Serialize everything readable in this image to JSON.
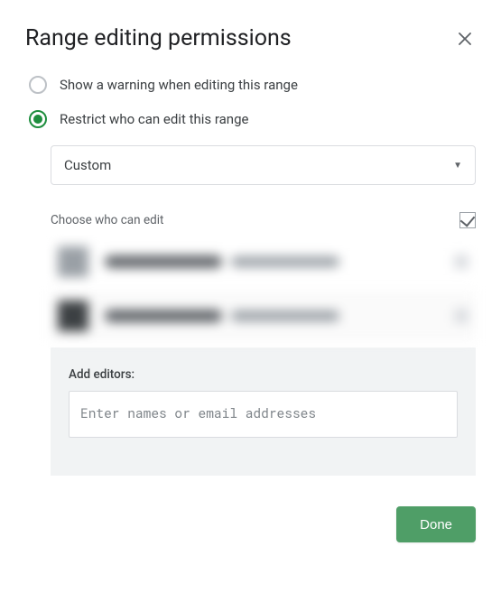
{
  "dialog": {
    "title": "Range editing permissions"
  },
  "radios": {
    "warning_label": "Show a warning when editing this range",
    "restrict_label": "Restrict who can edit this range",
    "selected": "restrict"
  },
  "permission_select": {
    "value": "Custom"
  },
  "choose_label": "Choose who can edit",
  "master_checkbox_checked": true,
  "users": [
    {
      "name_redacted": true,
      "email_redacted": true,
      "checked": true
    },
    {
      "name_redacted": true,
      "email_redacted": true,
      "checked": true
    }
  ],
  "add_editors": {
    "label": "Add editors:",
    "placeholder": "Enter names or email addresses",
    "value": ""
  },
  "buttons": {
    "done": "Done"
  },
  "colors": {
    "accent_green": "#1e8e3e",
    "button_green": "#4f9e67",
    "border": "#dadce0",
    "text_primary": "#202124",
    "text_secondary": "#5f6368",
    "panel_bg": "#f1f3f4"
  }
}
